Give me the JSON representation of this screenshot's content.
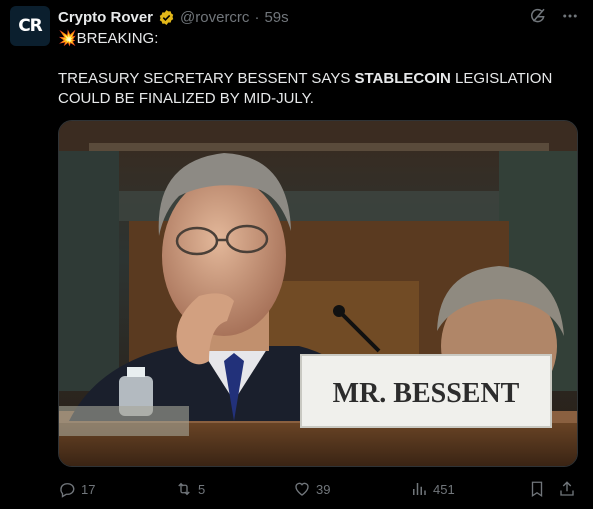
{
  "post": {
    "author_name": "Crypto Rover",
    "author_handle": "@rovercrc",
    "separator": "·",
    "time": "59s",
    "avatar_text": "CR",
    "line1": "💥BREAKING:",
    "line2_part1": "TREASURY SECRETARY BESSENT SAYS ",
    "line2_bold": "STABLECOIN",
    "line2_part2": " LEGISLATION COULD BE FINALIZED BY MID-JULY.",
    "image": {
      "nameplate": "MR. BESSENT"
    }
  },
  "actions": {
    "replies": "17",
    "reposts": "5",
    "likes": "39",
    "views": "451"
  },
  "icons": {
    "grok": "grok-icon",
    "more": "more-icon",
    "reply": "reply-icon",
    "repost": "repost-icon",
    "like": "heart-icon",
    "views": "views-icon",
    "bookmark": "bookmark-icon",
    "share": "share-icon",
    "verified": "verified-badge-icon"
  },
  "colors": {
    "background": "#000000",
    "text": "#e7e9ea",
    "muted": "#71767b",
    "verified": "#e2b719"
  }
}
